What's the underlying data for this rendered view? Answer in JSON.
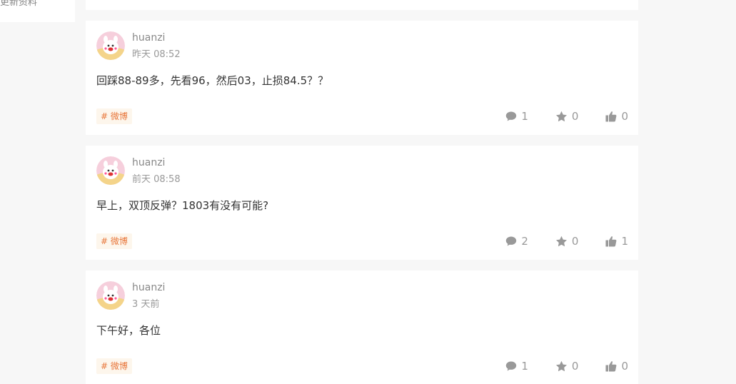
{
  "sidebar": {
    "update_profile_label": "更新资料"
  },
  "posts": [
    {
      "author": "huanzi",
      "time": "昨天 08:52",
      "content": "回踩88-89多，先看96，然后03，止损84.5？？",
      "tag": "# 微博",
      "comments": "1",
      "favorites": "0",
      "likes": "0"
    },
    {
      "author": "huanzi",
      "time": "前天 08:58",
      "content": "早上，双顶反弹？1803有没有可能?",
      "tag": "# 微博",
      "comments": "2",
      "favorites": "0",
      "likes": "1"
    },
    {
      "author": "huanzi",
      "time": "3 天前",
      "content": "下午好，各位",
      "tag": "# 微博",
      "comments": "1",
      "favorites": "0",
      "likes": "0"
    }
  ],
  "icons": {
    "comment": "comment-icon",
    "favorite": "star-icon",
    "like": "thumbs-up-icon"
  },
  "colors": {
    "tag_text": "#e8773b",
    "tag_bg": "#fdf6ec",
    "meta_gray": "#999999",
    "page_bg": "#f7f7f7"
  }
}
